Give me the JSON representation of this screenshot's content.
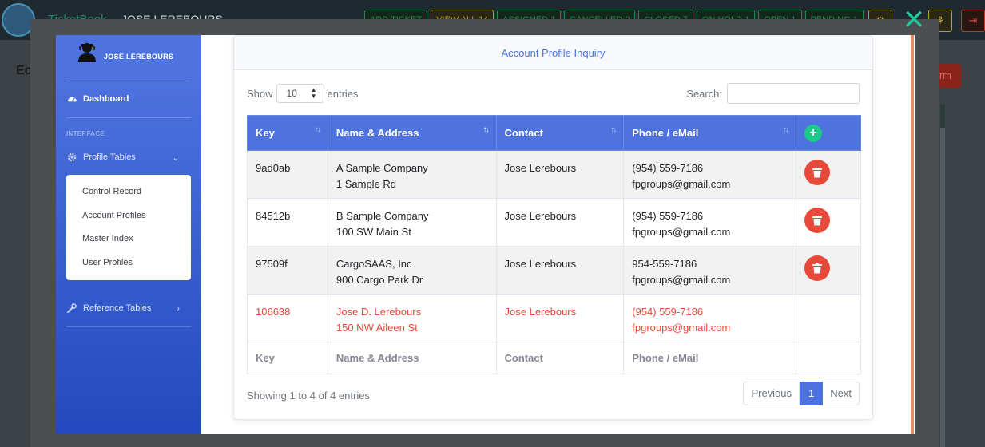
{
  "background": {
    "brand": "TicketBook",
    "user": "JOSE LEREBOURS",
    "pills": [
      "ADD TICKET",
      "VIEW ALL 14",
      "ASSIGNED 1",
      "CANCELLED 0",
      "CLOSED 7",
      "ON HOLD 1",
      "OPEN 1",
      "PENDING 1"
    ],
    "page_title": "Ec",
    "red_button": "rm"
  },
  "sidebar": {
    "user_name": "JOSE LEREBOURS",
    "dashboard": "Dashboard",
    "heading": "INTERFACE",
    "profile_tables": "Profile Tables",
    "submenu": [
      "Control Record",
      "Account Profiles",
      "Master Index",
      "User Profiles"
    ],
    "reference_tables": "Reference Tables"
  },
  "card": {
    "title": "Account Profile Inquiry",
    "show_label": "Show",
    "entries_value": "10",
    "entries_label": "entries",
    "search_label": "Search:",
    "columns": [
      "Key",
      "Name & Address",
      "Contact",
      "Phone / eMail"
    ],
    "rows": [
      {
        "key": "9ad0ab",
        "name": "A Sample Company",
        "address": "1 Sample Rd",
        "contact": "Jose Lerebours",
        "phone": "(954) 559-7186",
        "email": "fpgroups@gmail.com",
        "deletable": true
      },
      {
        "key": "84512b",
        "name": "B Sample Company",
        "address": "100 SW Main St",
        "contact": "Jose Lerebours",
        "phone": "(954) 559-7186",
        "email": "fpgroups@gmail.com",
        "deletable": true
      },
      {
        "key": "97509f",
        "name": "CargoSAAS, Inc",
        "address": "900 Cargo Park Dr",
        "contact": "Jose Lerebours",
        "phone": "954-559-7186",
        "email": "fpgroups@gmail.com",
        "deletable": true
      },
      {
        "key": "106638",
        "name": "Jose D. Lerebours",
        "address": "150 NW Aileen St",
        "contact": "Jose Lerebours",
        "phone": "(954) 559-7186",
        "email": "fpgroups@gmail.com",
        "deletable": false
      }
    ],
    "info": "Showing 1 to 4 of 4 entries",
    "pager": {
      "previous": "Previous",
      "page": "1",
      "next": "Next"
    }
  },
  "colors": {
    "primary": "#4e73df",
    "danger": "#e74a3b",
    "success": "#1cc88a",
    "close": "#20c997"
  }
}
